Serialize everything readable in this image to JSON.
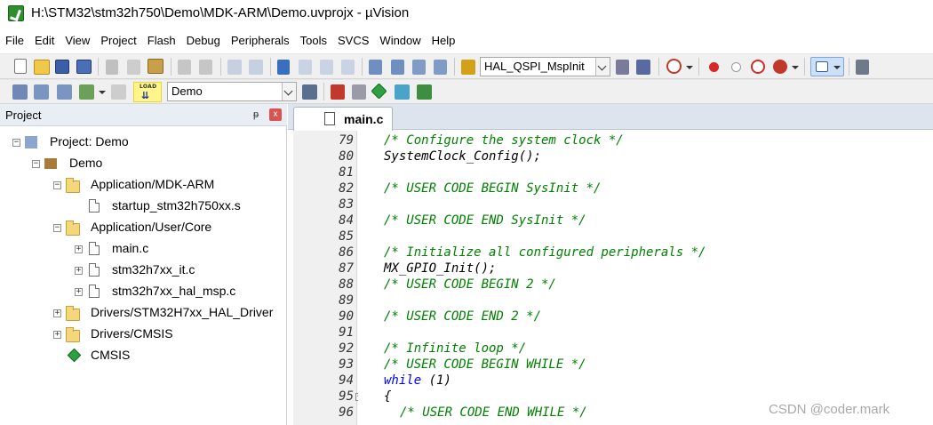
{
  "window": {
    "title": "H:\\STM32\\stm32h750\\Demo\\MDK-ARM\\Demo.uvprojx - µVision"
  },
  "menu": [
    "File",
    "Edit",
    "View",
    "Project",
    "Flash",
    "Debug",
    "Peripherals",
    "Tools",
    "SVCS",
    "Window",
    "Help"
  ],
  "toolbar": {
    "function_combo": "HAL_QSPI_MspInit",
    "target_combo": "Demo",
    "load_label": "LOAD"
  },
  "project_panel": {
    "title": "Project",
    "pin": "ᵽ",
    "close": "x",
    "tree": [
      {
        "label": "Project: Demo",
        "kind": "project",
        "level": 0,
        "expander": "−"
      },
      {
        "label": "Demo",
        "kind": "target",
        "level": 1,
        "expander": "−"
      },
      {
        "label": "Application/MDK-ARM",
        "kind": "folder",
        "level": 2,
        "expander": "−"
      },
      {
        "label": "startup_stm32h750xx.s",
        "kind": "file",
        "level": 3,
        "expander": ""
      },
      {
        "label": "Application/User/Core",
        "kind": "folder",
        "level": 2,
        "expander": "−"
      },
      {
        "label": "main.c",
        "kind": "file",
        "level": 3,
        "expander": "+"
      },
      {
        "label": "stm32h7xx_it.c",
        "kind": "file",
        "level": 3,
        "expander": "+"
      },
      {
        "label": "stm32h7xx_hal_msp.c",
        "kind": "file",
        "level": 3,
        "expander": "+"
      },
      {
        "label": "Drivers/STM32H7xx_HAL_Driver",
        "kind": "folder",
        "level": 2,
        "expander": "+"
      },
      {
        "label": "Drivers/CMSIS",
        "kind": "folder",
        "level": 2,
        "expander": "+"
      },
      {
        "label": "CMSIS",
        "kind": "component",
        "level": 2,
        "expander": ""
      }
    ]
  },
  "editor": {
    "active_tab": "main.c",
    "fold_marker": "−",
    "lines": [
      {
        "no": "79",
        "text": "/* Configure the system clock */",
        "type": "comment",
        "indent": 0
      },
      {
        "no": "80",
        "text": "SystemClock_Config();",
        "type": "normal",
        "indent": 0
      },
      {
        "no": "81",
        "text": "",
        "type": "normal",
        "indent": 0
      },
      {
        "no": "82",
        "text": "/* USER CODE BEGIN SysInit */",
        "type": "comment",
        "indent": 0
      },
      {
        "no": "83",
        "text": "",
        "type": "normal",
        "indent": 0
      },
      {
        "no": "84",
        "text": "/* USER CODE END SysInit */",
        "type": "comment",
        "indent": 0
      },
      {
        "no": "85",
        "text": "",
        "type": "normal",
        "indent": 0
      },
      {
        "no": "86",
        "text": "/* Initialize all configured peripherals */",
        "type": "comment",
        "indent": 0
      },
      {
        "no": "87",
        "text": "MX_GPIO_Init();",
        "type": "normal",
        "indent": 0
      },
      {
        "no": "88",
        "text": "/* USER CODE BEGIN 2 */",
        "type": "comment",
        "indent": 0
      },
      {
        "no": "89",
        "text": "",
        "type": "normal",
        "indent": 0
      },
      {
        "no": "90",
        "text": "/* USER CODE END 2 */",
        "type": "comment",
        "indent": 0
      },
      {
        "no": "91",
        "text": "",
        "type": "normal",
        "indent": 0
      },
      {
        "no": "92",
        "text": "/* Infinite loop */",
        "type": "comment",
        "indent": 0
      },
      {
        "no": "93",
        "text": "/* USER CODE BEGIN WHILE */",
        "type": "comment",
        "indent": 0
      },
      {
        "no": "94",
        "text": "while (1)",
        "type": "while",
        "indent": 0
      },
      {
        "no": "95",
        "text": "{",
        "type": "normal",
        "indent": 0,
        "fold": true
      },
      {
        "no": "96",
        "text": "/* USER CODE END WHILE */",
        "type": "comment",
        "indent": 1
      }
    ]
  },
  "watermark": "CSDN @coder.mark"
}
